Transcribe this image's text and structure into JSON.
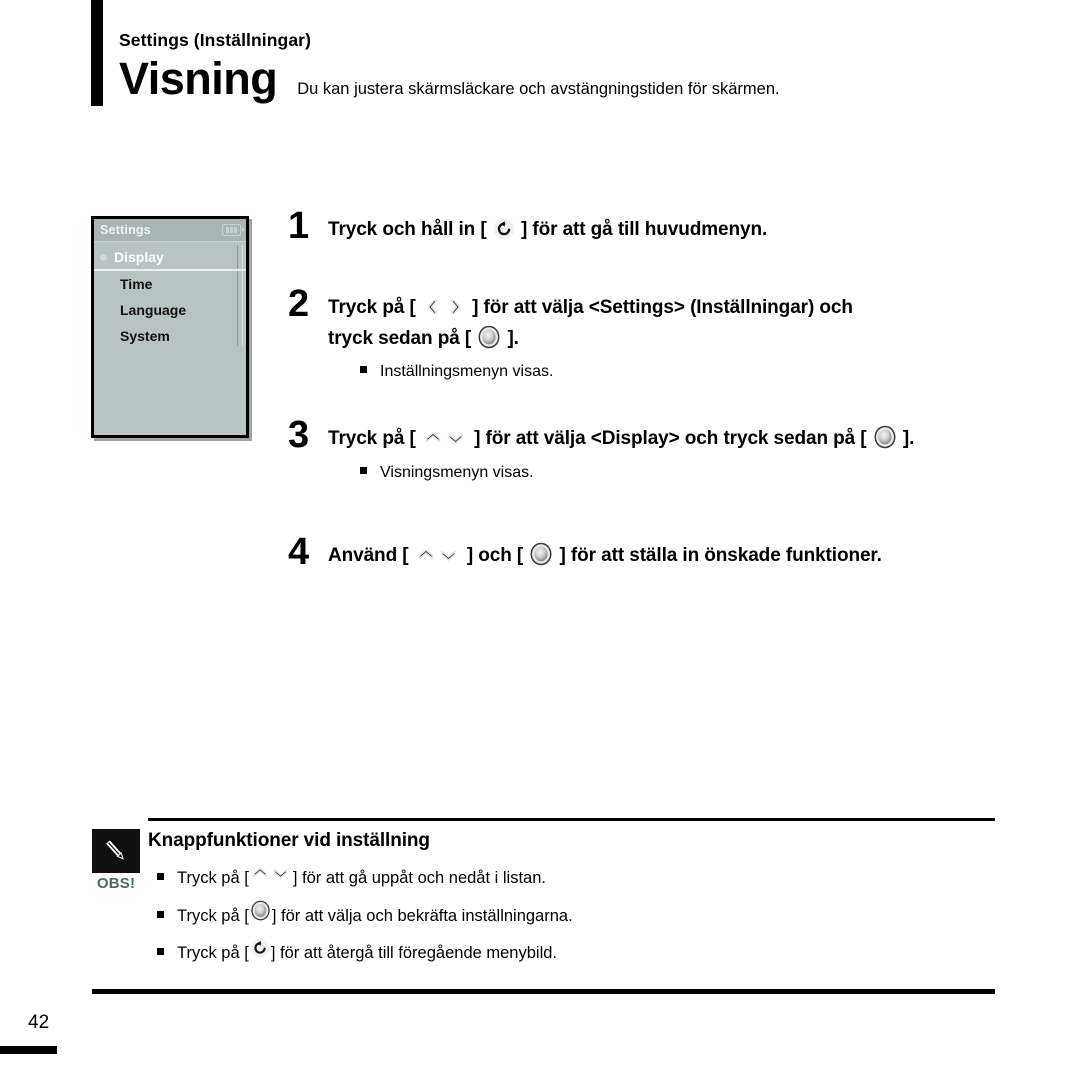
{
  "header": {
    "eyebrow": "Settings (Inställningar)",
    "title": "Visning",
    "subtitle": "Du kan justera skärmsläckare och avstängningstiden för skärmen."
  },
  "device_screen": {
    "title": "Settings",
    "battery_icon": "battery-icon",
    "items": [
      {
        "label": "Display",
        "selected": true
      },
      {
        "label": "Time",
        "selected": false
      },
      {
        "label": "Language",
        "selected": false
      },
      {
        "label": "System",
        "selected": false
      }
    ]
  },
  "steps": [
    {
      "number": "1",
      "text_before": "Tryck och håll in [",
      "icon": "return-icon",
      "text_after": "] för att gå till huvudmenyn.",
      "substep": ""
    },
    {
      "number": "2",
      "line1_before": "Tryck på [",
      "line1_icon": "left-right-chevron-icon",
      "line1_after": "] för att välja <Settings> (Inställningar) och",
      "line2_before": "tryck sedan på [",
      "line2_icon": "select-icon",
      "line2_after": "].",
      "substep": "Inställningsmenyn visas."
    },
    {
      "number": "3",
      "text_before": "Tryck på [",
      "icon1": "up-down-chevron-icon",
      "text_middle": "] för att välja <Display> och tryck sedan på [",
      "icon2": "select-icon",
      "text_after": "].",
      "substep": "Visningsmenyn visas."
    },
    {
      "number": "4",
      "text_before": "Använd [",
      "icon1": "up-down-chevron-icon",
      "text_middle": "] och [",
      "icon2": "select-icon",
      "text_after": "] för att ställa in önskade funktioner.",
      "substep": ""
    }
  ],
  "note": {
    "badge_label": "OBS!",
    "badge_icon": "pencil-icon",
    "heading": "Knappfunktioner vid inställning",
    "lines": [
      {
        "before": "Tryck på  [",
        "icon": "up-down-chevron-icon",
        "after": "] för att gå uppåt och nedåt i listan."
      },
      {
        "before": "Tryck på  [",
        "icon": "select-icon",
        "after": "] för att välja och bekräfta inställningarna."
      },
      {
        "before": "Tryck på  [",
        "icon": "return-icon",
        "after": "] för att återgå till föregående menybild."
      }
    ]
  },
  "footer": {
    "page_number": "42"
  },
  "colors": {
    "lcd_body": "#b7c4c2",
    "lcd_titlebar": "#a8b5b3",
    "accent_black": "#000000",
    "obs_label": "#4a6a6a"
  }
}
